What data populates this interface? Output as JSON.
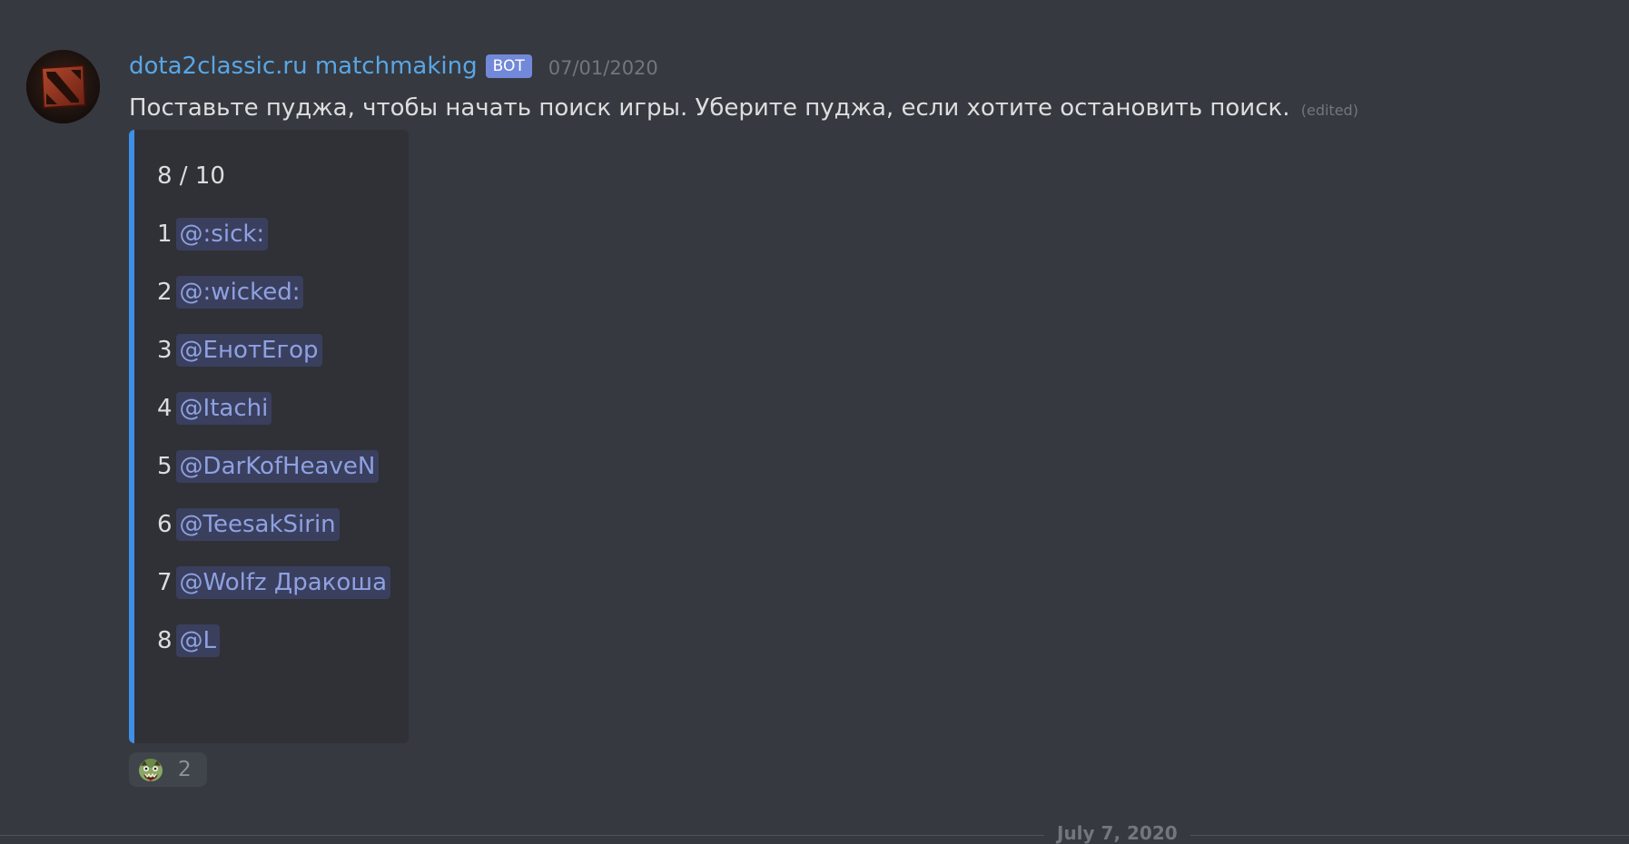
{
  "message": {
    "author": "dota2classic.ru matchmaking",
    "bot_tag": "BOT",
    "timestamp": "07/01/2020",
    "content": "Поставьте пуджа, чтобы начать поиск игры. Уберите пуджа, если хотите остановить поиск.",
    "edited_label": "(edited)",
    "avatar_icon": "dota2-logo-icon"
  },
  "embed": {
    "accent_color": "#3e8fe8",
    "count": "8 / 10",
    "players": [
      {
        "num": "1",
        "mention": "@:sick:"
      },
      {
        "num": "2",
        "mention": "@:wicked:"
      },
      {
        "num": "3",
        "mention": "@ЕнотЕгор"
      },
      {
        "num": "4",
        "mention": "@Itachi"
      },
      {
        "num": "5",
        "mention": "@DarKofHeaveN"
      },
      {
        "num": "6",
        "mention": "@TeesakSirin"
      },
      {
        "num": "7",
        "mention": "@Wolfz Дракоша"
      },
      {
        "num": "8",
        "mention": "@L"
      }
    ]
  },
  "reaction": {
    "emoji": "pudge-emoji-icon",
    "count": "2"
  },
  "divider": {
    "date": "July 7, 2020"
  },
  "colors": {
    "background": "#36393f",
    "username": "#58a6e6",
    "bot_tag": "#7289da",
    "mention_text": "#8ea1e1",
    "mention_bg": "#3a3f5e"
  }
}
